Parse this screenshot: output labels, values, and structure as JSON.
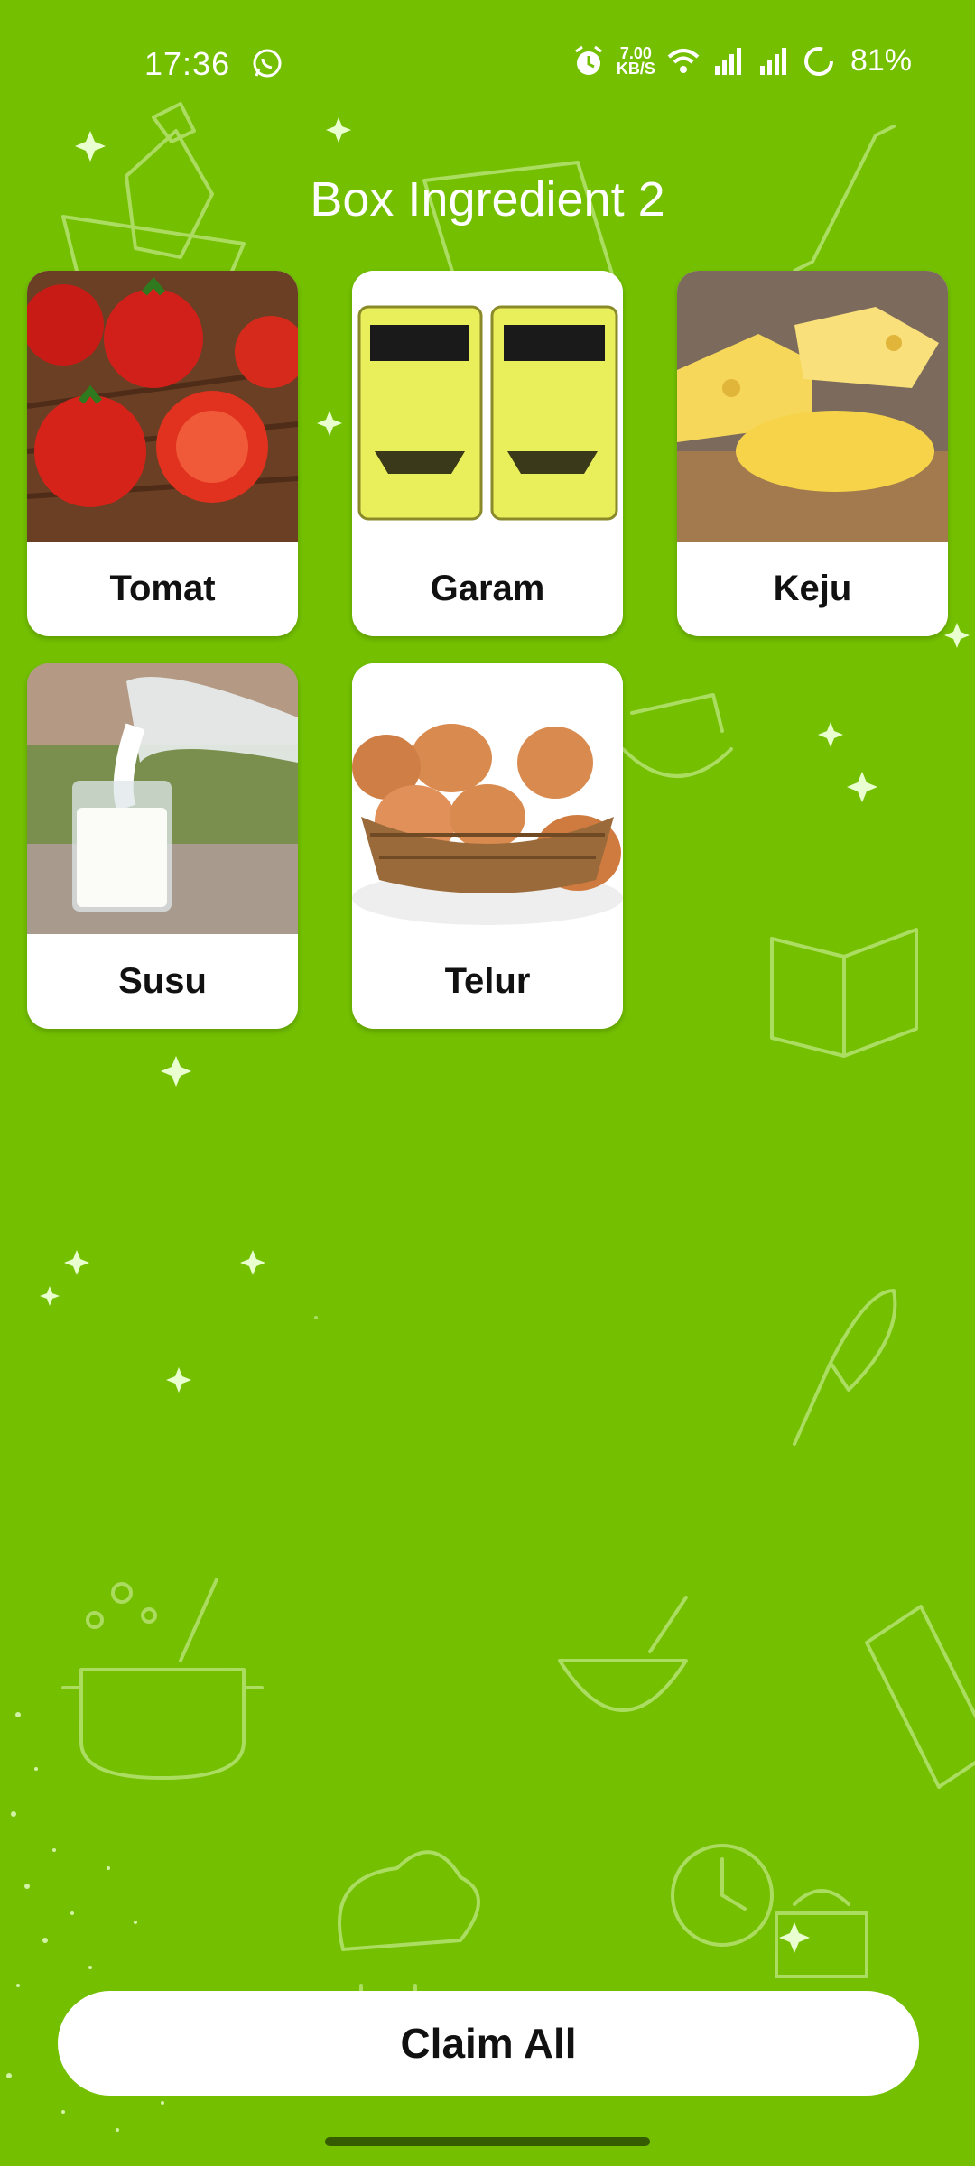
{
  "status_bar": {
    "time": "17:36",
    "net_speed_value": "7.00",
    "net_speed_unit": "KB/S",
    "battery": "81%"
  },
  "page": {
    "title": "Box Ingredient 2"
  },
  "ingredients": [
    {
      "label": "Tomat",
      "image": "tomatoes-photo"
    },
    {
      "label": "Garam",
      "image": "salt-packets-photo"
    },
    {
      "label": "Keju",
      "image": "cheese-photo"
    },
    {
      "label": "Susu",
      "image": "milk-photo"
    },
    {
      "label": "Telur",
      "image": "eggs-photo"
    }
  ],
  "actions": {
    "claim_all": "Claim All"
  },
  "colors": {
    "background": "#73bf00",
    "card": "#ffffff",
    "title_text": "#ffffff"
  }
}
